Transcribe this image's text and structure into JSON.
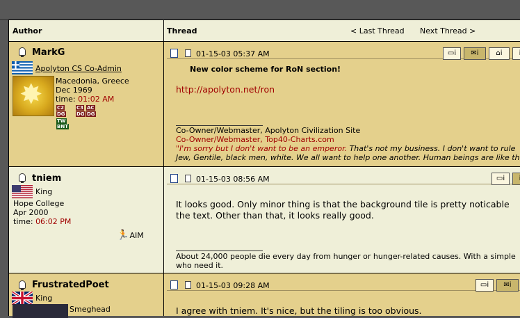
{
  "header": {
    "author_label": "Author",
    "thread_label": "Thread",
    "last_thread": "< Last Thread",
    "next_thread": "Next Thread >"
  },
  "posts": [
    {
      "username": "MarkG",
      "user_title": "Apolyton CS Co-Admin",
      "flag": "greece",
      "location": "Macedonia, Greece",
      "joined": "Dec 1969",
      "time_label": "time:",
      "time": "01:02 AM",
      "badges": [
        "C2",
        "C3",
        "AC",
        "DG",
        "DG",
        "DG",
        "TW",
        "BNT"
      ],
      "date": "01-15-03 05:37 AM",
      "post_title": "New color scheme for RoN section!",
      "body": [
        "http://apolyton.net/ron"
      ],
      "sig_line1": "Co-Owner/Webmaster, Apolyton Civilization Site",
      "sig_line2": "Co-Owner/Webmaster, Top40-Charts.com",
      "sig_quote1": "\"I'm sorry but I don't want to be an emperor.",
      "sig_quote2": " That's not my business. I don't want to rule",
      "sig_quote3": "Jew, Gentile, black men, white. We all want to help one another. Human beings are like th"
    },
    {
      "username": "tniem",
      "user_title": "King",
      "flag": "usa",
      "location": "Hope College",
      "joined": "Apr 2000",
      "time_label": "time:",
      "time": "06:02 PM",
      "aim": "AIM",
      "date": "01-15-03 08:56 AM",
      "body": [
        "It looks good. Only minor thing is that the background tile is pretty noticable",
        "the text. Other than that, it looks really good."
      ],
      "sig_line1": "About 24,000 people die every day from hunger or hunger-related causes. With a simple",
      "sig_line2": "who need it."
    },
    {
      "username": "FrustratedPoet",
      "user_title": "King",
      "flag": "uk",
      "location": "Smeghead",
      "date": "01-15-03 09:28 AM",
      "body": [
        "I agree with tniem. It's nice, but the tiling is too obvious."
      ]
    }
  ],
  "colors": {
    "gold_row": "#e4d08c",
    "cream_row": "#efefd8",
    "accent_red": "#a00000"
  }
}
